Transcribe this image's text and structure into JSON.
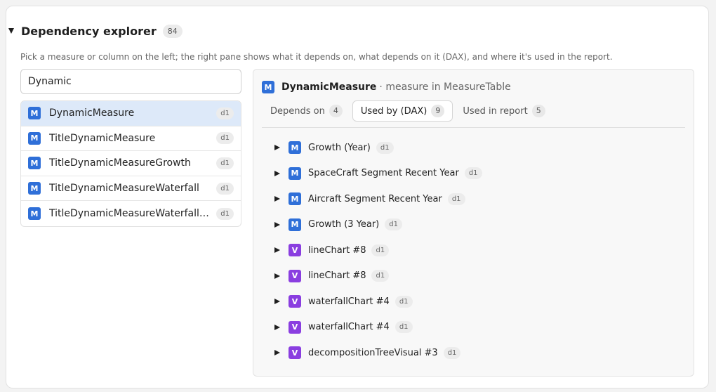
{
  "explorer": {
    "title": "Dependency explorer",
    "count": "84",
    "description": "Pick a measure or column on the left; the right pane shows what it depends on, what depends on it (DAX), and where it's used in the report."
  },
  "search": {
    "value": "Dynamic"
  },
  "list": [
    {
      "label": "DynamicMeasure",
      "tag": "d1",
      "icon": "M",
      "selected": true
    },
    {
      "label": "TitleDynamicMeasure",
      "tag": "d1",
      "icon": "M"
    },
    {
      "label": "TitleDynamicMeasureGrowth",
      "tag": "d1",
      "icon": "M"
    },
    {
      "label": "TitleDynamicMeasureWaterfall",
      "tag": "d1",
      "icon": "M"
    },
    {
      "label": "TitleDynamicMeasureWaterfallCa...",
      "tag": "d1",
      "icon": "M"
    }
  ],
  "detail": {
    "icon": "M",
    "name": "DynamicMeasure",
    "subtitle": "· measure in MeasureTable",
    "tabs": [
      {
        "label": "Depends on",
        "count": "4"
      },
      {
        "label": "Used by (DAX)",
        "count": "9",
        "active": true
      },
      {
        "label": "Used in report",
        "count": "5"
      }
    ],
    "items": [
      {
        "icon": "M",
        "label": "Growth (Year)",
        "tag": "d1"
      },
      {
        "icon": "M",
        "label": "SpaceCraft Segment Recent Year",
        "tag": "d1"
      },
      {
        "icon": "M",
        "label": "Aircraft Segment Recent Year",
        "tag": "d1"
      },
      {
        "icon": "M",
        "label": "Growth (3 Year)",
        "tag": "d1"
      },
      {
        "icon": "V",
        "label": "lineChart #8",
        "tag": "d1"
      },
      {
        "icon": "V",
        "label": "lineChart #8",
        "tag": "d1"
      },
      {
        "icon": "V",
        "label": "waterfallChart #4",
        "tag": "d1"
      },
      {
        "icon": "V",
        "label": "waterfallChart #4",
        "tag": "d1"
      },
      {
        "icon": "V",
        "label": "decompositionTreeVisual #3",
        "tag": "d1"
      }
    ]
  },
  "colors": {
    "measure_icon": "#2f6fd8",
    "visual_icon": "#8a3ee0",
    "selected_row": "#dde9f9"
  }
}
